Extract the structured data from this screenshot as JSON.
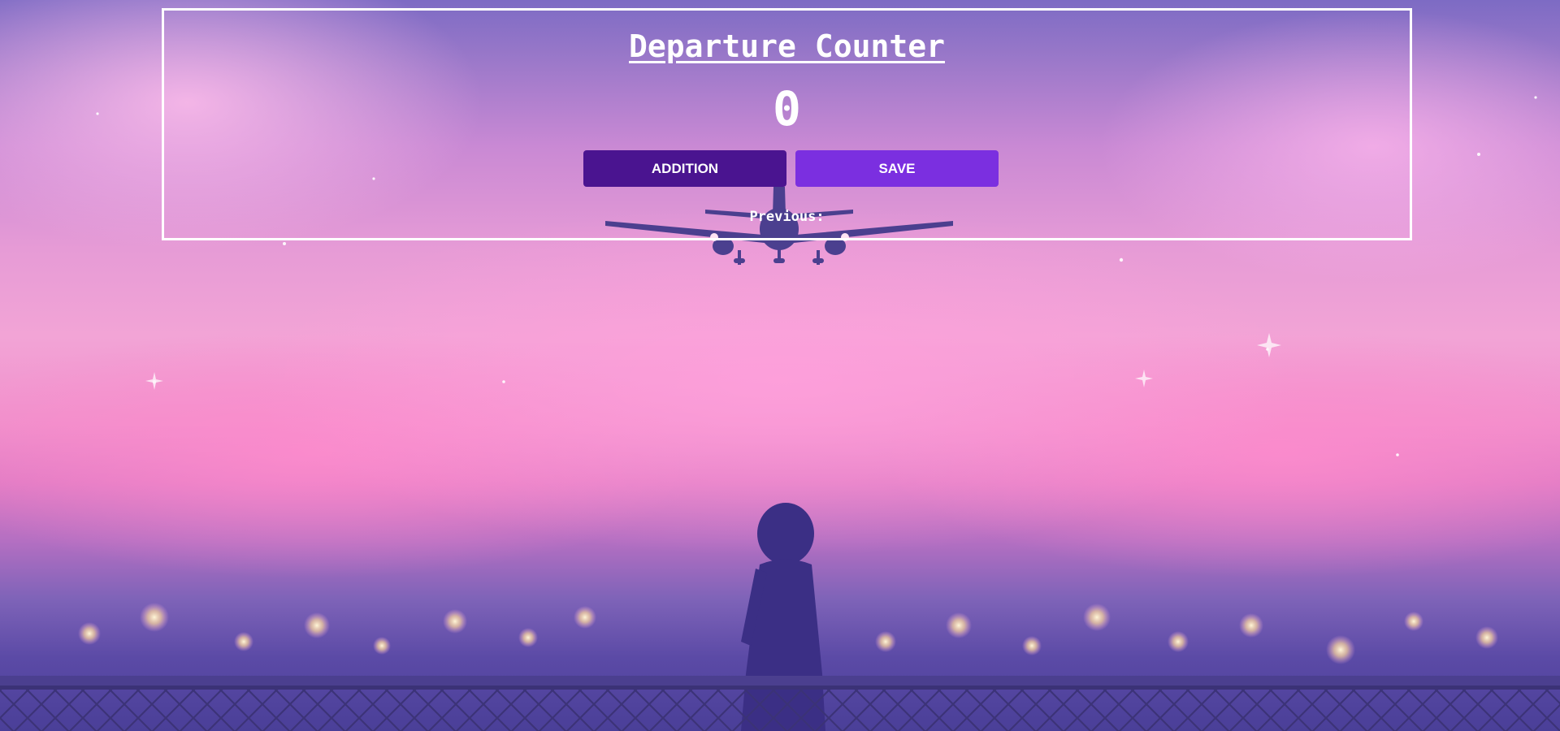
{
  "app": {
    "title": "Departure Counter",
    "count": "0"
  },
  "buttons": {
    "addition_label": "ADDITION",
    "save_label": "SAVE"
  },
  "previous": {
    "label": "Previous:"
  },
  "icons": {
    "airplane": "airplane-illustration",
    "person": "person-silhouette"
  },
  "colors": {
    "addition_button": "#4a1490",
    "save_button": "#7b2fe0",
    "text": "#ffffff",
    "panel_border": "#ffffff"
  }
}
